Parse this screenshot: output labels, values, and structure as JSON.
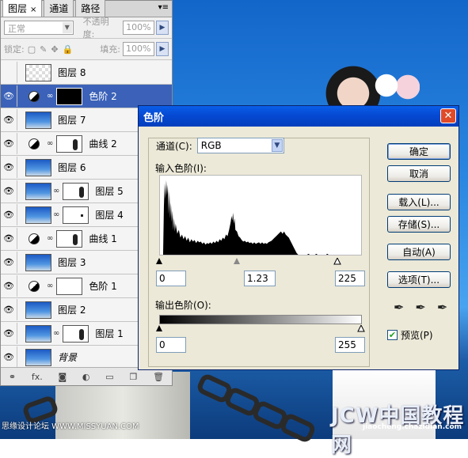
{
  "layers_panel": {
    "tabs": [
      {
        "label": "图层",
        "close": "×"
      },
      {
        "label": "通道"
      },
      {
        "label": "路径"
      }
    ],
    "blend_mode": "正常",
    "opacity_label": "不透明度:",
    "opacity_value": "100%",
    "lock_label": "锁定:",
    "fill_label": "填充:",
    "fill_value": "100%",
    "layers": [
      {
        "name": "图层 8",
        "type": "pixel",
        "thumb": "checker",
        "visible": false,
        "selected": false
      },
      {
        "name": "色阶 2",
        "type": "adjustment",
        "mask": "black",
        "visible": true,
        "selected": true
      },
      {
        "name": "图层 7",
        "type": "pixel",
        "thumb": "sky",
        "visible": true,
        "selected": false
      },
      {
        "name": "曲线 2",
        "type": "adjustment",
        "mask": "figure",
        "visible": true,
        "selected": false
      },
      {
        "name": "图层 6",
        "type": "pixel",
        "thumb": "sky",
        "visible": true,
        "selected": false
      },
      {
        "name": "图层 5",
        "type": "pixel_mask",
        "thumb": "sky",
        "mask": "figure",
        "visible": true,
        "selected": false
      },
      {
        "name": "图层 4",
        "type": "pixel_mask",
        "thumb": "sky",
        "mask": "dot",
        "visible": true,
        "selected": false
      },
      {
        "name": "曲线 1",
        "type": "adjustment",
        "mask": "figure",
        "visible": true,
        "selected": false
      },
      {
        "name": "图层 3",
        "type": "pixel",
        "thumb": "sky",
        "visible": true,
        "selected": false
      },
      {
        "name": "色阶 1",
        "type": "adjustment",
        "mask": "white",
        "visible": true,
        "selected": false
      },
      {
        "name": "图层 2",
        "type": "pixel",
        "thumb": "sky",
        "visible": true,
        "selected": false
      },
      {
        "name": "图层 1",
        "type": "pixel_mask",
        "thumb": "sky",
        "mask": "figure",
        "visible": true,
        "selected": false
      },
      {
        "name": "背景",
        "type": "background",
        "thumb": "sky",
        "visible": true,
        "selected": false
      }
    ],
    "footer_icons": [
      "link-icon",
      "fx-icon",
      "mask-icon",
      "adjustment-icon",
      "folder-icon",
      "new-layer-icon",
      "trash-icon"
    ],
    "footer_fx": "fx."
  },
  "levels_dialog": {
    "title": "色阶",
    "close": "✕",
    "channel_label": "通道(C):",
    "channel_value": "RGB",
    "input_label": "输入色阶(I):",
    "input_black": "0",
    "input_gamma": "1.23",
    "input_white": "225",
    "output_label": "输出色阶(O):",
    "output_black": "0",
    "output_white": "255",
    "buttons": {
      "ok": "确定",
      "cancel": "取消",
      "load": "载入(L)...",
      "save": "存储(S)...",
      "auto": "自动(A)",
      "options": "选项(T)..."
    },
    "preview_label": "预览(P)",
    "preview_checked": true
  },
  "watermarks": {
    "left": "思缘设计论坛 WWW.MISSYUAN.COM",
    "right_big": "JCW中国教程网",
    "right_small": "jiaocheng.chazidian.com"
  },
  "colors": {
    "selection": "#3b62b8",
    "titlebar": "#0548d0",
    "dialog_bg": "#ece9d8"
  }
}
